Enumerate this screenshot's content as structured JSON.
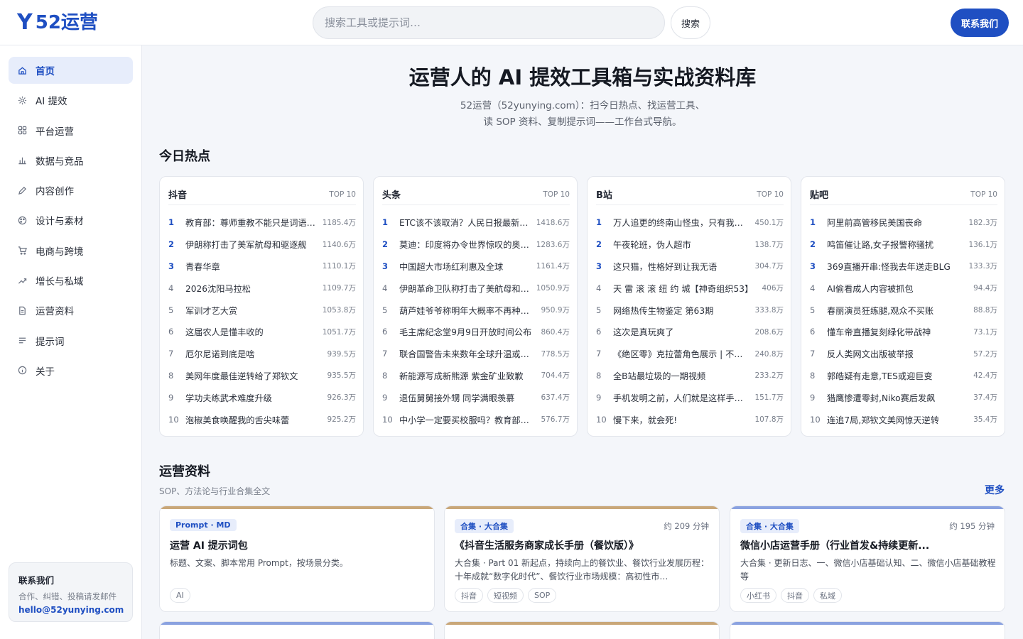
{
  "header": {
    "logo_mark": "Y",
    "logo_text": "52运营",
    "search_placeholder": "搜索工具或提示词…",
    "search_button": "搜索",
    "contact_button": "联系我们"
  },
  "sidebar": {
    "items": [
      {
        "label": "首页",
        "icon": "home-icon"
      },
      {
        "label": "AI 提效",
        "icon": "sparkle-icon"
      },
      {
        "label": "平台运营",
        "icon": "grid-icon"
      },
      {
        "label": "数据与竞品",
        "icon": "bar-chart-icon"
      },
      {
        "label": "内容创作",
        "icon": "pencil-icon"
      },
      {
        "label": "设计与素材",
        "icon": "palette-icon"
      },
      {
        "label": "电商与跨境",
        "icon": "cart-icon"
      },
      {
        "label": "增长与私域",
        "icon": "trend-icon"
      },
      {
        "label": "运营资料",
        "icon": "document-icon"
      },
      {
        "label": "提示词",
        "icon": "list-icon"
      },
      {
        "label": "关于",
        "icon": "info-icon"
      }
    ],
    "contact": {
      "title": "联系我们",
      "desc": "合作、纠错、投稿请发邮件",
      "email": "hello@52yunying.com"
    }
  },
  "hero": {
    "title": "运营人的 AI 提效工具箱与实战资料库",
    "sub_line1": "52运营（52yunying.com）：扫今日热点、找运营工具、",
    "sub_line2": "读 SOP 资料、复制提示词——工作台式导航。"
  },
  "hot": {
    "section_title": "今日热点",
    "top_label": "TOP 10",
    "boards": [
      {
        "name": "抖音",
        "items": [
          {
            "title": "教育部：尊师重教不能只是词语…",
            "value": "1185.4万"
          },
          {
            "title": "伊朗称打击了美军航母和驱逐舰",
            "value": "1140.6万"
          },
          {
            "title": "青春华章",
            "value": "1110.1万"
          },
          {
            "title": "2026沈阳马拉松",
            "value": "1109.7万"
          },
          {
            "title": "军训才艺大赏",
            "value": "1053.8万"
          },
          {
            "title": "这届农人是懂丰收的",
            "value": "1051.7万"
          },
          {
            "title": "厄尔尼诺到底是啥",
            "value": "939.5万"
          },
          {
            "title": "美网年度最佳逆转给了郑钦文",
            "value": "935.5万"
          },
          {
            "title": "学功夫练武术难度升级",
            "value": "926.3万"
          },
          {
            "title": "泡椒美食唤醒我的舌尖味蕾",
            "value": "925.2万"
          }
        ]
      },
      {
        "name": "头条",
        "items": [
          {
            "title": "ETC该不该取消？人民日报最新…",
            "value": "1418.6万"
          },
          {
            "title": "莫迪：印度将办令世界惊叹的奥…",
            "value": "1283.6万"
          },
          {
            "title": "中国超大市场红利惠及全球",
            "value": "1161.4万"
          },
          {
            "title": "伊朗革命卫队称打击了美航母和…",
            "value": "1050.9万"
          },
          {
            "title": "葫芦娃爷爷称明年大概率不再种…",
            "value": "950.9万"
          },
          {
            "title": "毛主席纪念堂9月9日开放时间公布",
            "value": "860.4万"
          },
          {
            "title": "联合国警告未来数年全球升温或…",
            "value": "778.5万"
          },
          {
            "title": "新能源写成新熊源 紫金矿业致歉",
            "value": "704.4万"
          },
          {
            "title": "退伍舅舅接外甥 同学满眼羡慕",
            "value": "637.4万"
          },
          {
            "title": "中小学一定要买校服吗？教育部…",
            "value": "576.7万"
          }
        ]
      },
      {
        "name": "B站",
        "items": [
          {
            "title": "万人追更的终南山怪虫，只有我…",
            "value": "450.1万"
          },
          {
            "title": "午夜轮班，伪人超市",
            "value": "138.7万"
          },
          {
            "title": "这只猫，性格好到让我无语",
            "value": "304.7万"
          },
          {
            "title": "天 雷 滚 滚 纽 约 城【神奇组织53】",
            "value": "406万"
          },
          {
            "title": "网络热传生物鉴定 第63期",
            "value": "333.8万"
          },
          {
            "title": "这次是真玩爽了",
            "value": "208.6万"
          },
          {
            "title": "《绝区零》克拉蕾角色展示 | 不…",
            "value": "240.8万"
          },
          {
            "title": "全B站最垃圾的一期视频",
            "value": "233.2万"
          },
          {
            "title": "手机发明之前，人们就是这样手…",
            "value": "151.7万"
          },
          {
            "title": "慢下来，就会死!",
            "value": "107.8万"
          }
        ]
      },
      {
        "name": "贴吧",
        "items": [
          {
            "title": "阿里前高管移民美国丧命",
            "value": "182.3万"
          },
          {
            "title": "鸣笛催让路,女子报警称骚扰",
            "value": "136.1万"
          },
          {
            "title": "369直播开串:怪我去年送走BLG",
            "value": "133.3万"
          },
          {
            "title": "AI偷看成人内容被抓包",
            "value": "94.4万"
          },
          {
            "title": "春丽演员狂练腿,观众不买账",
            "value": "88.8万"
          },
          {
            "title": "懂车帝直播复刻绿化带战神",
            "value": "73.1万"
          },
          {
            "title": "反人类网文出版被举报",
            "value": "57.2万"
          },
          {
            "title": "郭皓疑有走意,TES或迎巨变",
            "value": "42.4万"
          },
          {
            "title": "猎鹰惨遭零封,Niko赛后发飙",
            "value": "37.4万"
          },
          {
            "title": "连追7局,郑钦文美网惊天逆转",
            "value": "35.4万"
          }
        ]
      }
    ]
  },
  "resources": {
    "section_title": "运营资料",
    "sub": "SOP、方法论与行业合集全文",
    "more": "更多",
    "cards": [
      {
        "tag": "Prompt · MD",
        "time": "",
        "title": "运营 AI 提示词包",
        "desc": "标题、文案、脚本常用 Prompt，按场景分类。",
        "chips": [
          "AI"
        ],
        "accent": "#c9a779"
      },
      {
        "tag": "合集 · 大合集",
        "time": "约 209 分钟",
        "title": "《抖音生活服务商家成长手册（餐饮版）》",
        "desc": "大合集 · Part 01 新起点，持续向上的餐饮业、餐饮行业发展历程：十年成就“数字化时代”、餐饮行业市场规模：高初性市…",
        "chips": [
          "抖音",
          "短视频",
          "SOP"
        ],
        "accent": "#c9a779"
      },
      {
        "tag": "合集 · 大合集",
        "time": "约 195 分钟",
        "title": "微信小店运营手册（行业首发&持续更新...",
        "desc": "大合集 · 更新日志、一、微信小店基础认知、二、微信小店基础教程 等",
        "chips": [
          "小红书",
          "抖音",
          "私域"
        ],
        "accent": "#8aa2e0"
      }
    ]
  }
}
